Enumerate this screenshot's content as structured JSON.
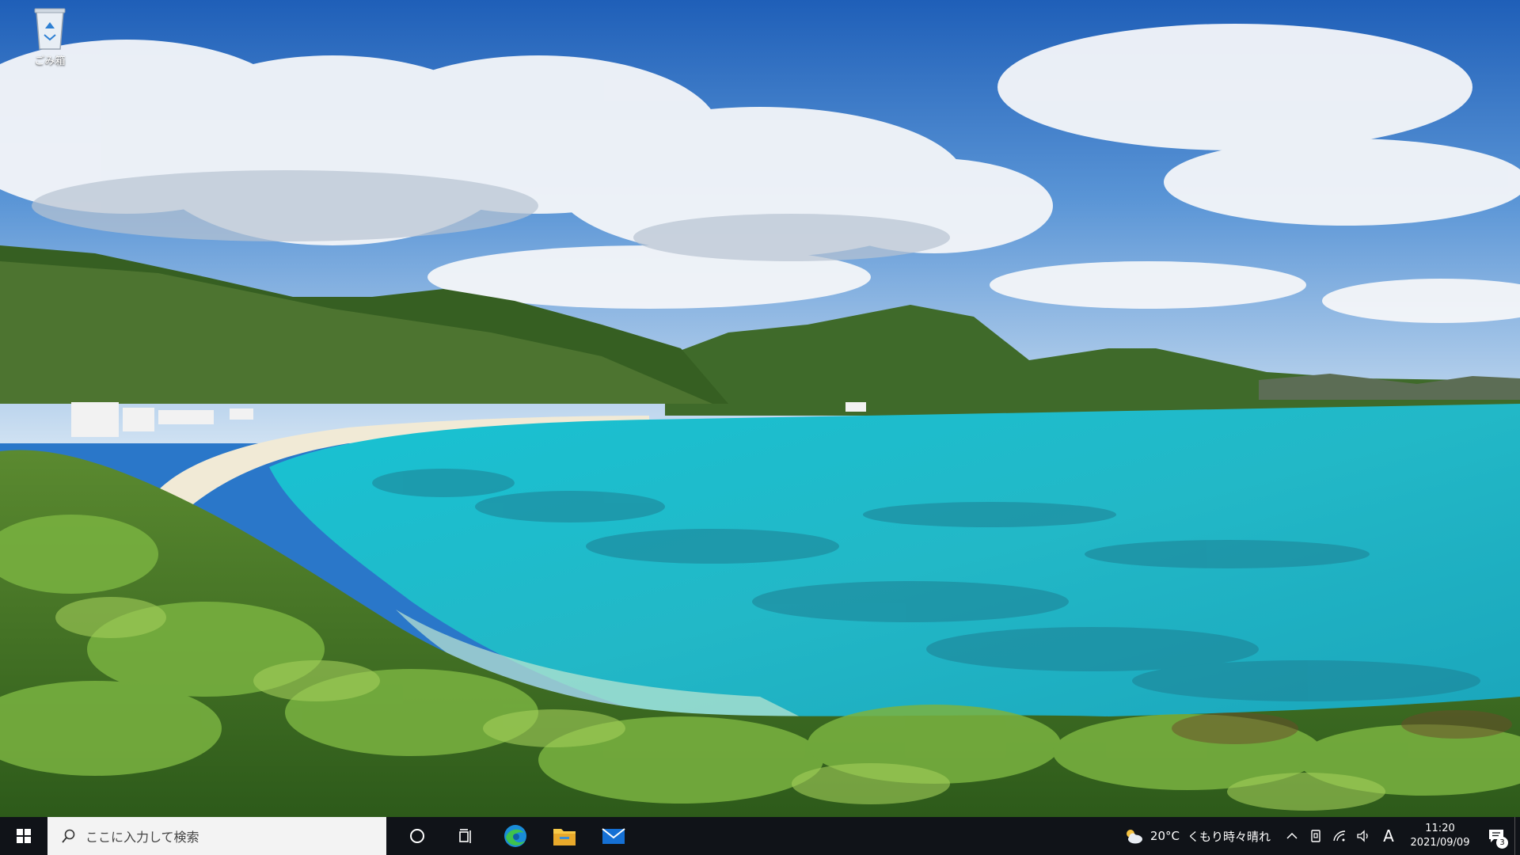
{
  "desktop": {
    "icons": [
      {
        "label": "ごみ箱",
        "icon": "recycle-bin-icon"
      }
    ]
  },
  "taskbar": {
    "search_placeholder": "ここに入力して検索",
    "apps": [
      {
        "name": "cortana",
        "icon": "cortana-icon"
      },
      {
        "name": "task-view",
        "icon": "task-view-icon"
      },
      {
        "name": "edge",
        "icon": "edge-icon"
      },
      {
        "name": "file-explorer",
        "icon": "folder-icon"
      },
      {
        "name": "mail",
        "icon": "mail-icon"
      }
    ],
    "weather": {
      "temp": "20°C",
      "condition": "くもり時々晴れ",
      "icon": "partly-cloudy-icon"
    },
    "ime_label": "A",
    "clock": {
      "time": "11:20",
      "date": "2021/09/09"
    },
    "notification_count": "3"
  },
  "colors": {
    "taskbar_bg": "#101318",
    "search_bg": "#f3f3f3",
    "edge_blue": "#1a8cd8",
    "edge_green": "#3fc24d",
    "folder_yellow": "#f7c948",
    "mail_blue": "#1570d4"
  }
}
